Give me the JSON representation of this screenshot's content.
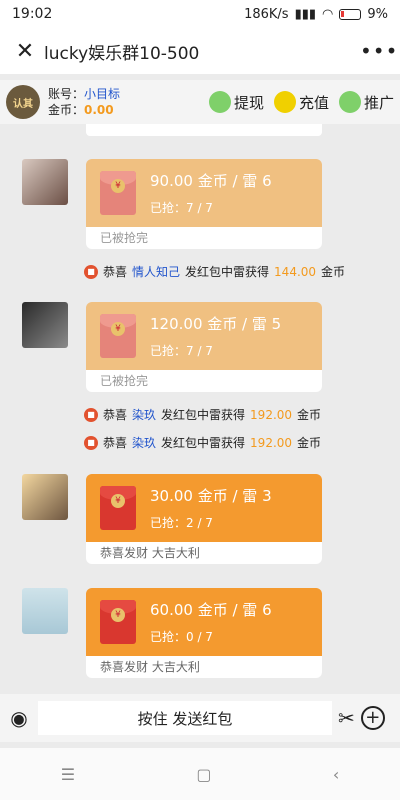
{
  "status": {
    "time": "19:02",
    "speed": "186K/s",
    "battery": "9%"
  },
  "header": {
    "title": "lucky娱乐群10-500"
  },
  "account": {
    "logo_text": "认其",
    "account_label": "账号：",
    "account_name": "小目标",
    "coin_label": "金币：",
    "coin_value": "0.00"
  },
  "actions": [
    {
      "label": "提现",
      "icon": "withdraw-icon",
      "color": "#7fd06a"
    },
    {
      "label": "充值",
      "icon": "recharge-icon",
      "color": "#f0d000"
    },
    {
      "label": "推广",
      "icon": "promote-icon",
      "color": "#7fd06a"
    }
  ],
  "messages": [
    {
      "amount": "90.00 金币 / 雷 6",
      "grab": "已抢：7 / 7",
      "footer": "已被抢完",
      "state": "done"
    },
    {
      "amount": "120.00 金币 / 雷 5",
      "grab": "已抢：7 / 7",
      "footer": "已被抢完",
      "state": "done"
    },
    {
      "amount": "30.00 金币 / 雷 3",
      "grab": "已抢：2 / 7",
      "footer": "恭喜发财 大吉大利",
      "state": "live"
    },
    {
      "amount": "60.00 金币 / 雷 6",
      "grab": "已抢：0 / 7",
      "footer": "恭喜发财 大吉大利",
      "state": "live"
    }
  ],
  "notices": [
    {
      "prefix": "恭喜",
      "who": "情人知己",
      "mid": "发红包中雷获得",
      "amount": "144.00",
      "unit": "金币"
    },
    {
      "prefix": "恭喜",
      "who": "染玖",
      "mid": "发红包中雷获得",
      "amount": "192.00",
      "unit": "金币"
    },
    {
      "prefix": "恭喜",
      "who": "染玖",
      "mid": "发红包中雷获得",
      "amount": "192.00",
      "unit": "金币"
    }
  ],
  "bottom": {
    "hold_label": "按住 发送红包"
  },
  "colors": {
    "accent_orange": "#f49a2f",
    "link_blue": "#2255cc",
    "coin_orange": "#f39a1e"
  }
}
